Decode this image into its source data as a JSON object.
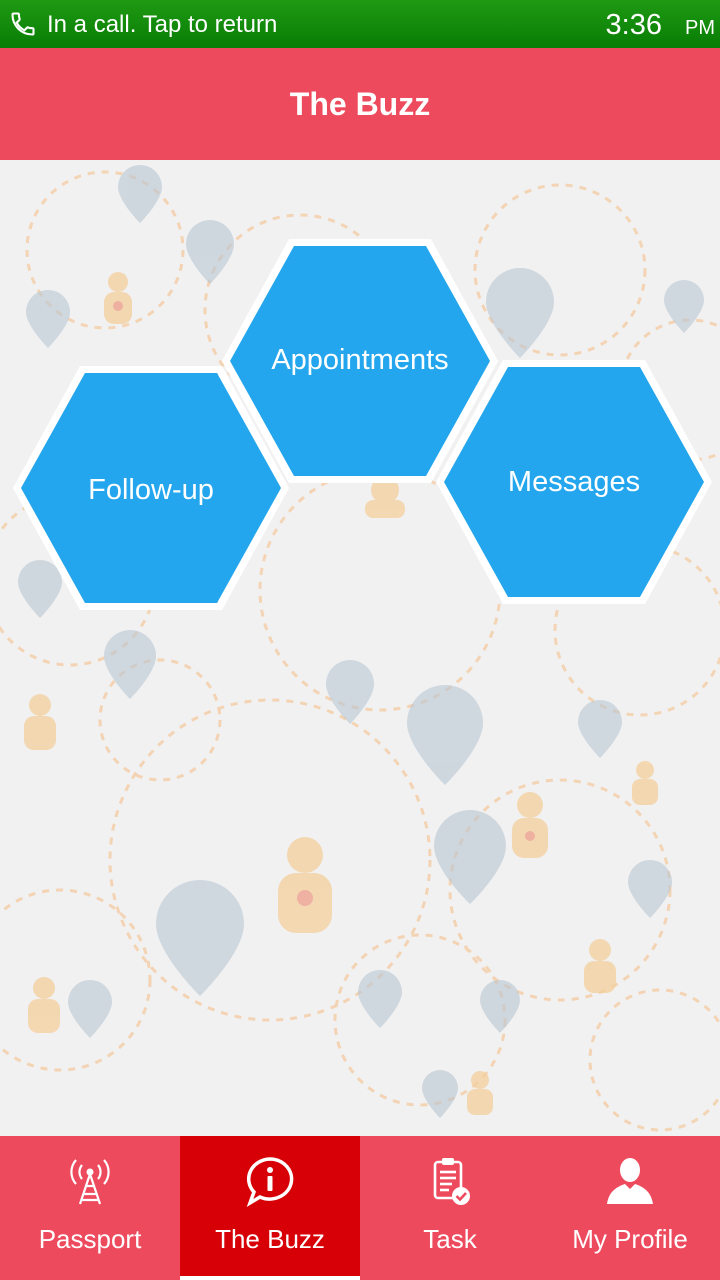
{
  "status_bar": {
    "call_text": "In a call. Tap to return",
    "time": "3:36",
    "ampm": "PM"
  },
  "header": {
    "title": "The Buzz"
  },
  "main": {
    "tiles": [
      {
        "label": "Appointments"
      },
      {
        "label": "Follow-up"
      },
      {
        "label": "Messages"
      }
    ],
    "tile_color": "#23a6ed"
  },
  "bottom_nav": {
    "items": [
      {
        "label": "Passport",
        "icon": "antenna-icon"
      },
      {
        "label": "The Buzz",
        "icon": "info-bubble-icon",
        "active": true
      },
      {
        "label": "Task",
        "icon": "clipboard-check-icon"
      },
      {
        "label": "My Profile",
        "icon": "person-icon"
      }
    ]
  },
  "colors": {
    "accent": "#ee4a5d",
    "active_tab": "#d60006",
    "status_bar": "#0f8a0a"
  }
}
